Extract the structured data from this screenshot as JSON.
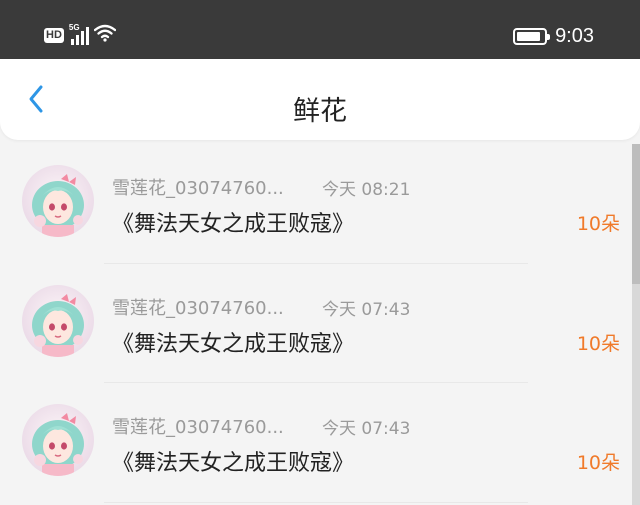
{
  "status_bar": {
    "hd_label": "HD",
    "network_label": "5G",
    "time": "9:03",
    "battery_level": 0.9,
    "icons": [
      "hd-icon",
      "signal-icon",
      "wifi-icon",
      "battery-icon"
    ]
  },
  "header": {
    "title": "鲜花",
    "back_icon": "chevron-left-icon"
  },
  "colors": {
    "accent_blue": "#2e96e6",
    "count_orange": "#f07a2a",
    "muted_gray": "#9a9a9a",
    "status_bar_bg": "#3a3a3a"
  },
  "gifts": [
    {
      "name": "雪莲花_03074760...",
      "time": "今天 08:21",
      "book": "《舞法天女之成王败寇》",
      "count": "10朵"
    },
    {
      "name": "雪莲花_03074760...",
      "time": "今天 07:43",
      "book": "《舞法天女之成王败寇》",
      "count": "10朵"
    },
    {
      "name": "雪莲花_03074760...",
      "time": "今天 07:43",
      "book": "《舞法天女之成王败寇》",
      "count": "10朵"
    }
  ]
}
